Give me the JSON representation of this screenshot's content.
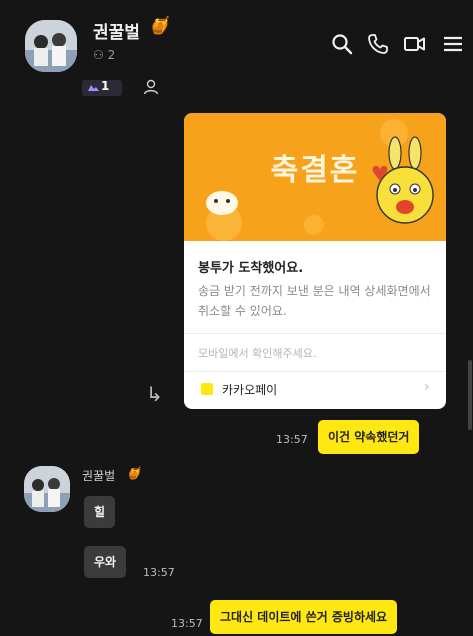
{
  "header": {
    "title": "권꿀벌",
    "title_emoji": "🍯",
    "member_count": "2",
    "icons": [
      "search-icon",
      "phone-icon",
      "video-call-icon",
      "menu-icon"
    ],
    "notice_badge_count": "1"
  },
  "card": {
    "banner_title": "축결혼",
    "heading": "봉투가 도착했어요.",
    "description": "송금 받기 전까지 보낸 분은 내역 상세화면에서 취소할 수 있어요.",
    "note": "모바일에서 확인해주세요.",
    "pay_label": "카카오페이",
    "chevron": "›"
  },
  "messages": {
    "my1": {
      "text": "이건 약속했던거",
      "time": "13:57"
    },
    "sender": {
      "name": "권꿀벌",
      "emoji": "🍯"
    },
    "their1": {
      "text": "힐"
    },
    "their2": {
      "text": "우와",
      "time": "13:57"
    },
    "my2": {
      "text": "그대신 데이트에 쓴거 증빙하세요",
      "time": "13:57"
    }
  },
  "colors": {
    "background": "#151515",
    "my_bubble": "#ffe812",
    "their_bubble": "#3b3b3b",
    "card_banner": "#f6a21a"
  }
}
